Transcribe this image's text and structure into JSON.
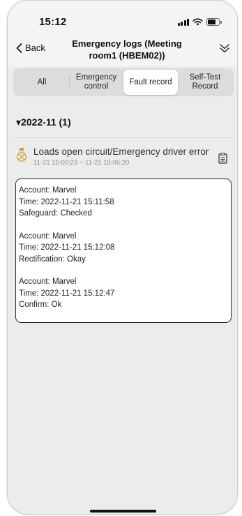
{
  "status_bar": {
    "time": "15:12"
  },
  "nav": {
    "back_label": "Back",
    "title": "Emergency logs (Meeting room1 (HBEM02))"
  },
  "tabs": [
    {
      "label": "All",
      "active": false
    },
    {
      "label": "Emergency control",
      "active": false
    },
    {
      "label": "Fault record",
      "active": true
    },
    {
      "label": "Self-Test Record",
      "active": false
    }
  ],
  "group": {
    "label": "▾2022-11  (1)"
  },
  "record": {
    "icon": "emergency-light-icon",
    "title": "Loads open circuit/Emergency driver error",
    "time_range": "11-21 15:00:23 ~ 11-21 15:06:20",
    "action_icon": "document-icon"
  },
  "log_entries": [
    {
      "account": "Account: Marvel",
      "time": "Time: 2022-11-21 15:11:58",
      "detail": "Safeguard: Checked"
    },
    {
      "account": "Account: Marvel",
      "time": "Time: 2022-11-21 15:12:08",
      "detail": "Rectification: Okay"
    },
    {
      "account": "Account: Marvel",
      "time": "Time: 2022-11-21 15:12:47",
      "detail": "Confirm: Ok"
    }
  ],
  "colors": {
    "accent": "#c9a24a",
    "background": "#ececec"
  }
}
